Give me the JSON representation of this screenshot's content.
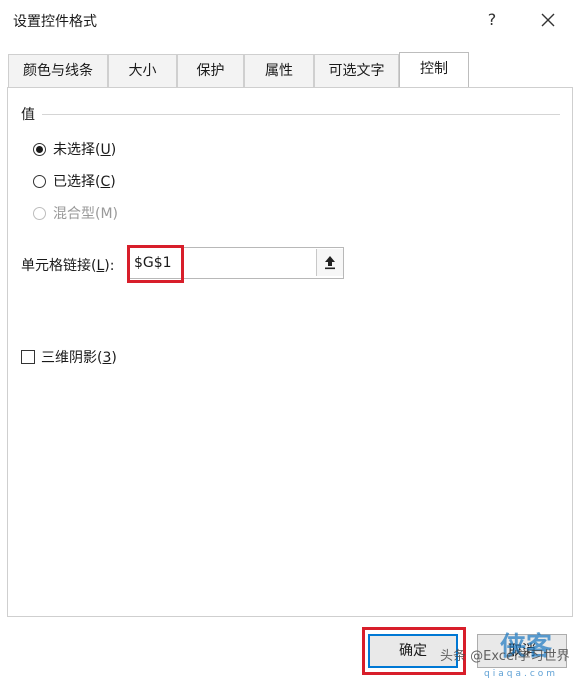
{
  "window": {
    "title": "设置控件格式",
    "help": "?",
    "close_icon": "close-icon"
  },
  "tabs": [
    {
      "label": "颜色与线条",
      "active": false
    },
    {
      "label": "大小",
      "active": false
    },
    {
      "label": "保护",
      "active": false
    },
    {
      "label": "属性",
      "active": false
    },
    {
      "label": "可选文字",
      "active": false
    },
    {
      "label": "控制",
      "active": true
    }
  ],
  "value_group": {
    "label": "值",
    "options": [
      {
        "text": "未选择(",
        "key": "U",
        "close": ")",
        "checked": true,
        "disabled": false
      },
      {
        "text": "已选择(",
        "key": "C",
        "close": ")",
        "checked": false,
        "disabled": false
      },
      {
        "text": "混合型(M)",
        "key": "",
        "close": "",
        "checked": false,
        "disabled": true
      }
    ]
  },
  "cell_link": {
    "label_pre": "单元格链接(",
    "label_key": "L",
    "label_post": "):",
    "value": "$G$1"
  },
  "shading": {
    "label_pre": "三维阴影(",
    "label_key": "3",
    "label_post": ")",
    "checked": false
  },
  "buttons": {
    "ok": "确定",
    "cancel": "取消"
  },
  "watermark": {
    "text": "头条 @Excel学习世界",
    "logo": "侠客",
    "url": "qiaqa.com"
  },
  "colors": {
    "highlight": "#d81e2a",
    "focus": "#0078d4"
  }
}
